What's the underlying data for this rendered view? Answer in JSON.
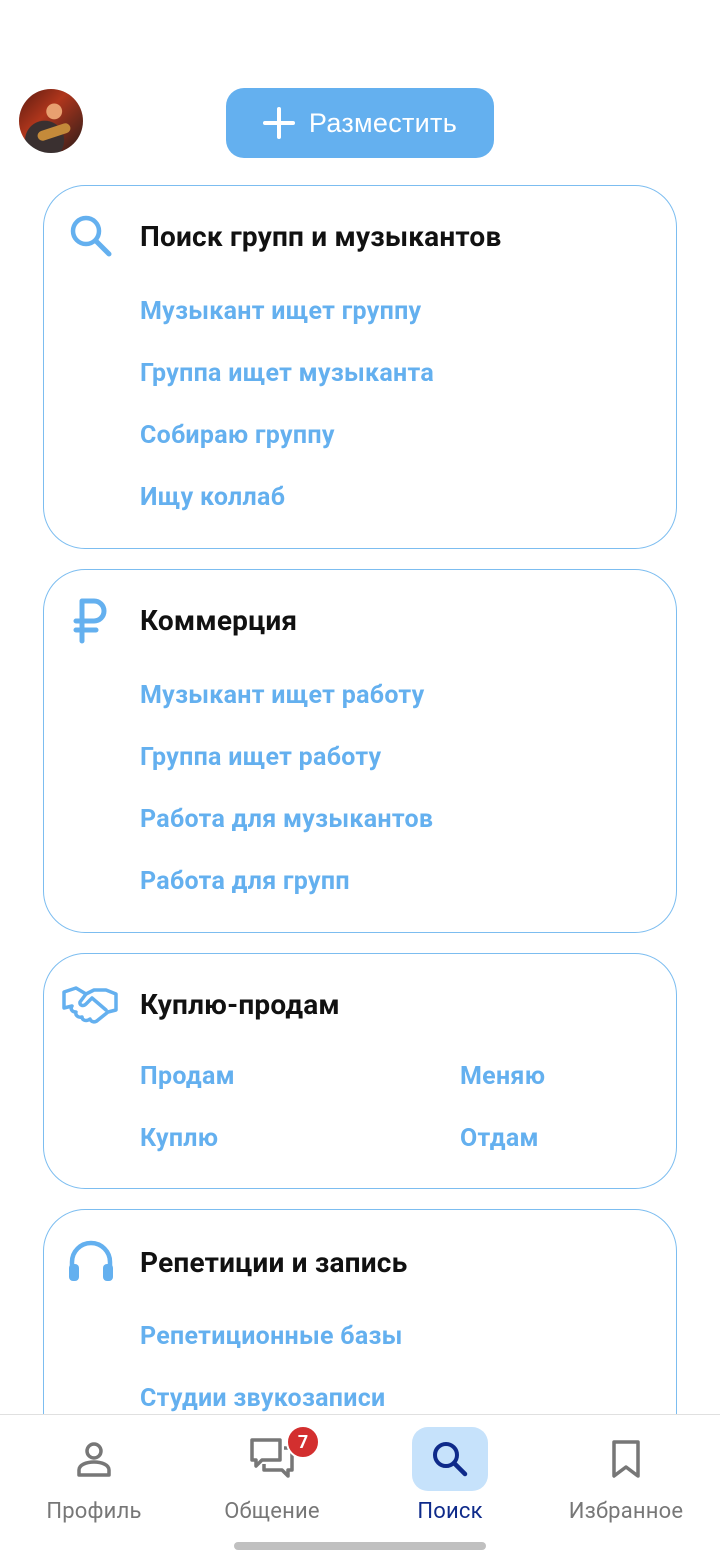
{
  "header": {
    "post_button_label": "Разместить"
  },
  "sections": [
    {
      "title": "Поиск групп и музыкантов",
      "icon": "search-icon",
      "links": [
        "Музыкант ищет группу",
        "Группа ищет музыканта",
        "Собираю группу",
        "Ищу коллаб"
      ]
    },
    {
      "title": "Коммерция",
      "icon": "ruble-icon",
      "links": [
        "Музыкант ищет работу",
        "Группа ищет работу",
        "Работа для музыкантов",
        "Работа для групп"
      ]
    },
    {
      "title": "Куплю-продам",
      "icon": "handshake-icon",
      "links": [
        "Продам",
        "Меняю",
        "Куплю",
        "Отдам"
      ]
    },
    {
      "title": "Репетиции и запись",
      "icon": "headphones-icon",
      "links": [
        "Репетиционные базы",
        "Студии звукозаписи"
      ]
    }
  ],
  "bottom_nav": {
    "items": [
      {
        "label": "Профиль",
        "icon": "person-icon"
      },
      {
        "label": "Общение",
        "icon": "chat-icon",
        "badge": "7"
      },
      {
        "label": "Поиск",
        "icon": "search-icon",
        "active": true
      },
      {
        "label": "Избранное",
        "icon": "bookmark-icon"
      }
    ]
  },
  "colors": {
    "accent": "#64b0ef",
    "card_border": "#7cbdf0",
    "active_nav_bg": "#c6e2fb",
    "active_nav_text": "#0e2a8a",
    "badge": "#d32f2f"
  }
}
